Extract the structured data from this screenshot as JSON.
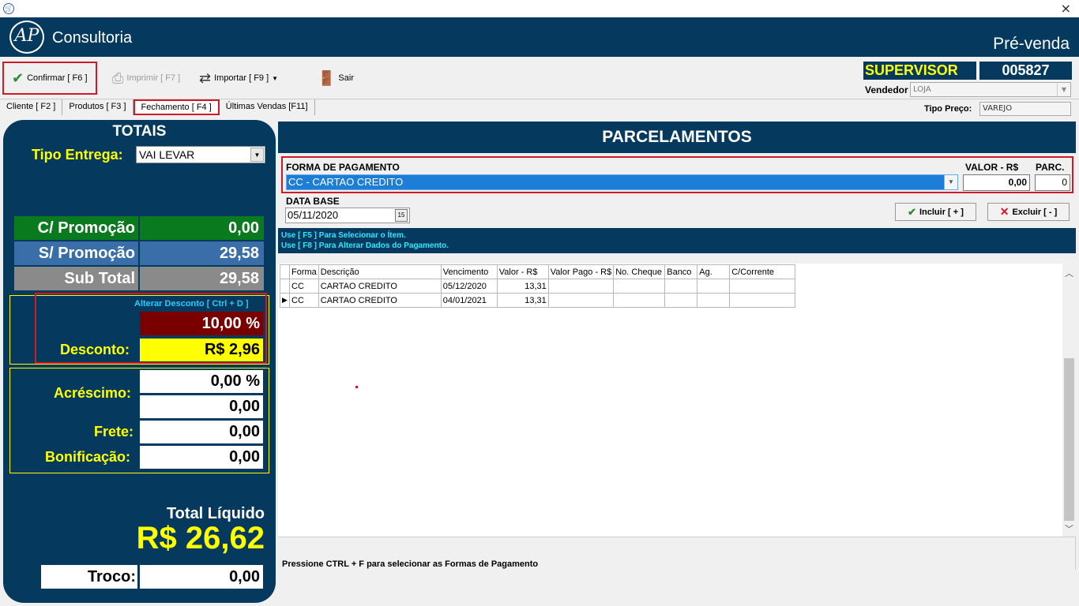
{
  "titlebar": {
    "app_icon": "cart-icon",
    "close": "×"
  },
  "banner": {
    "logo_mark": "AP",
    "logo_text": "Consultoria",
    "right_title": "Pré-venda"
  },
  "toolbar": {
    "confirmar": "Confirmar [ F6 ]",
    "imprimir": "Imprimir  [ F7 ]",
    "importar": "Importar [ F9 ]",
    "sair": "Sair"
  },
  "user": {
    "role": "SUPERVISOR",
    "code": "005827",
    "vendedor_label": "Vendedor",
    "vendedor_value": "LOJA"
  },
  "tabs": [
    {
      "label": "Cliente [ F2 ]"
    },
    {
      "label": "Produtos [ F3 ]"
    },
    {
      "label": "Fechamento [ F4 ]"
    },
    {
      "label": "Últimas Vendas [F11]"
    }
  ],
  "tipo_preco": {
    "label": "Tipo Preço:",
    "value": "VAREJO"
  },
  "totais": {
    "title": "TOTAIS",
    "tipo_entrega_label": "Tipo Entrega:",
    "tipo_entrega_value": "VAI LEVAR",
    "c_promocao_label": "C/ Promoção",
    "c_promocao_value": "0,00",
    "s_promocao_label": "S/ Promoção",
    "s_promocao_value": "29,58",
    "sub_total_label": "Sub Total",
    "sub_total_value": "29,58",
    "alterar_desconto": "Alterar Desconto  [ Ctrl + D ]",
    "desconto_pct": "10,00 %",
    "desconto_label": "Desconto:",
    "desconto_value": "R$ 2,96",
    "acrescimo_label": "Acréscimo:",
    "acrescimo_pct": "0,00 %",
    "acrescimo_value": "0,00",
    "frete_label": "Frete:",
    "frete_value": "0,00",
    "bonificacao_label": "Bonificação:",
    "bonificacao_value": "0,00",
    "total_liquido_label": "Total Líquido",
    "total_liquido_value": "R$ 26,62",
    "troco_label": "Troco:",
    "troco_value": "0,00"
  },
  "parcelamentos": {
    "title": "PARCELAMENTOS",
    "forma_label": "FORMA DE PAGAMENTO",
    "forma_value": "CC - CARTAO CREDITO",
    "valor_label": "VALOR - R$",
    "valor_value": "0,00",
    "parc_label": "PARC.",
    "parc_value": "0",
    "data_base_label": "DATA BASE",
    "data_base_value": "05/11/2020",
    "incluir": "Incluir [ + ]",
    "excluir": "Excluir [ - ]",
    "hint1": "Use [ F5 ] Para Selecionar o Ítem.",
    "hint2": "Use [ F8 ] Para Alterar Dados do Pagamento.",
    "columns": [
      "Forma",
      "Descrição",
      "Vencimento",
      "Valor - R$",
      "Valor Pago - R$",
      "No. Cheque",
      "Banco",
      "Ag.",
      "C/Corrente"
    ],
    "rows": [
      [
        "CC",
        "CARTAO CREDITO",
        "05/12/2020",
        "13,31",
        "",
        "",
        "",
        "",
        ""
      ],
      [
        "CC",
        "CARTAO CREDITO",
        "04/01/2021",
        "13,31",
        "",
        "",
        "",
        "",
        ""
      ]
    ],
    "status": "Pressione CTRL + F para selecionar as Formas de Pagamento"
  },
  "colors": {
    "navy": "#053a5e",
    "yellow": "#ffff00",
    "green": "#0a7a1f",
    "blue": "#3a6ea8",
    "gray": "#8a8a8a",
    "darkred": "#7a0000",
    "highlight": "#d01a2a"
  }
}
